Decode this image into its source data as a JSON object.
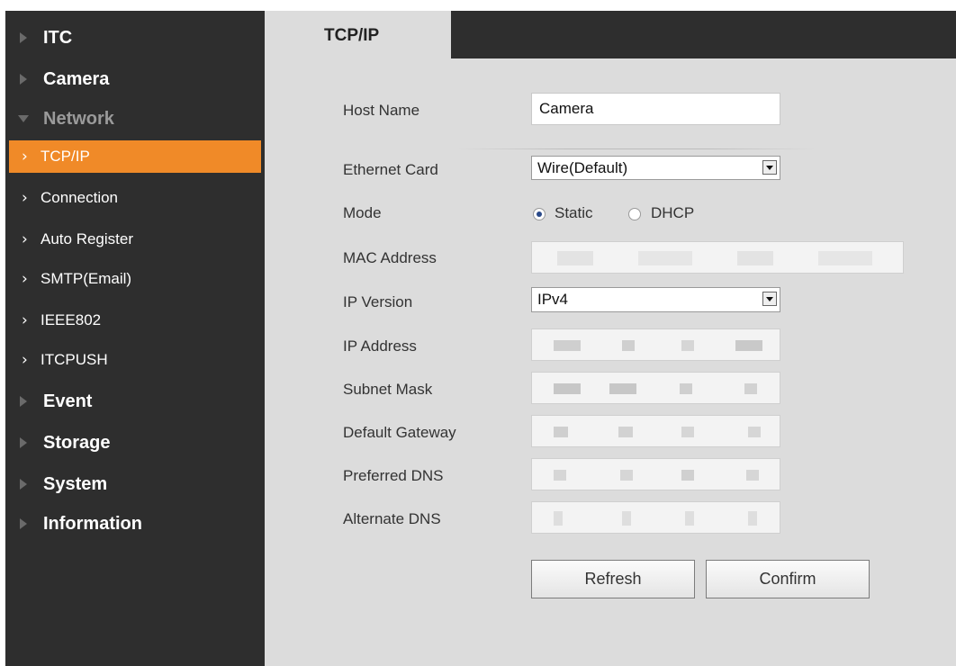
{
  "sidebar": {
    "itc": "ITC",
    "camera": "Camera",
    "network": "Network",
    "network_items": [
      "TCP/IP",
      "Connection",
      "Auto Register",
      "SMTP(Email)",
      "IEEE802",
      "ITCPUSH"
    ],
    "event": "Event",
    "storage": "Storage",
    "system": "System",
    "information": "Information",
    "active_color": "#f08a28"
  },
  "tab": {
    "label": "TCP/IP"
  },
  "form": {
    "host_name_label": "Host Name",
    "host_name_value": "Camera",
    "ethernet_card_label": "Ethernet Card",
    "ethernet_card_value": "Wire(Default)",
    "mode_label": "Mode",
    "mode_static": "Static",
    "mode_dhcp": "DHCP",
    "mode_selected": "Static",
    "mac_label": "MAC Address",
    "ip_version_label": "IP Version",
    "ip_version_value": "IPv4",
    "ip_address_label": "IP Address",
    "subnet_mask_label": "Subnet Mask",
    "default_gateway_label": "Default Gateway",
    "preferred_dns_label": "Preferred DNS",
    "alternate_dns_label": "Alternate DNS"
  },
  "buttons": {
    "refresh": "Refresh",
    "confirm": "Confirm"
  },
  "icons": {
    "collapsed": "triangle-right-icon",
    "expanded": "triangle-down-icon",
    "submenu": "chevron-right-icon",
    "dropdown": "chevron-down-icon"
  }
}
